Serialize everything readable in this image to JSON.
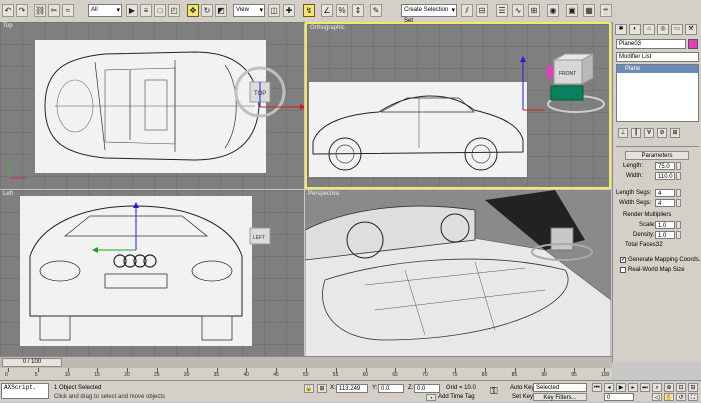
{
  "toolbar": {
    "selection_filter": "All",
    "ref_coord": "View",
    "named_selection": "Create Selection Set"
  },
  "viewports": {
    "top_label": "Top",
    "perspective_label": "Perspective",
    "viewcube_label": "FRONT",
    "viewcube_left": "LEFT"
  },
  "command_panel": {
    "object_name": "Plane03",
    "modifier_list": "Modifier List",
    "stack_item": "Plane",
    "rollout_title": "Parameters",
    "length_label": "Length:",
    "length_value": "75.0",
    "width_label": "Width:",
    "width_value": "110.0",
    "length_segs_label": "Length Segs:",
    "length_segs_value": "4",
    "width_segs_label": "Width Segs:",
    "width_segs_value": "4",
    "render_multipliers": "Render Multipliers",
    "scale_label": "Scale:",
    "scale_value": "1.0",
    "density_label": "Density:",
    "density_value": "1.0",
    "total_faces_label": "Total Faces:",
    "total_faces_value": "32",
    "gen_mapping": "Generate Mapping Coords.",
    "realworld_map": "Real-World Map Size"
  },
  "timeline": {
    "frame_counter": "0 / 100",
    "ticks": [
      "0",
      "5",
      "10",
      "15",
      "20",
      "25",
      "30",
      "35",
      "40",
      "45",
      "50",
      "55",
      "60",
      "65",
      "70",
      "75",
      "80",
      "85",
      "90",
      "95",
      "100"
    ]
  },
  "status": {
    "maxscript": "AXScript.",
    "selected": "1 Object Selected",
    "prompt": "Click and drag to select and move objects",
    "x_label": "X:",
    "x_value": "113.249",
    "y_label": "Y:",
    "y_value": "0.0",
    "z_label": "Z:",
    "z_value": "0.0",
    "grid": "Grid = 10.0",
    "add_time_tag": "Add Time Tag",
    "auto_key": "Auto Key",
    "selected_dropdown": "Selected",
    "set_key": "Set Key",
    "key_filters": "Key Filters...",
    "current_frame": "0"
  },
  "colors": {
    "active_border": "#f2e96a",
    "viewport_bg": "#7f7f7f",
    "ui_bg": "#d4d0c8",
    "object_color": "#e040c0"
  }
}
